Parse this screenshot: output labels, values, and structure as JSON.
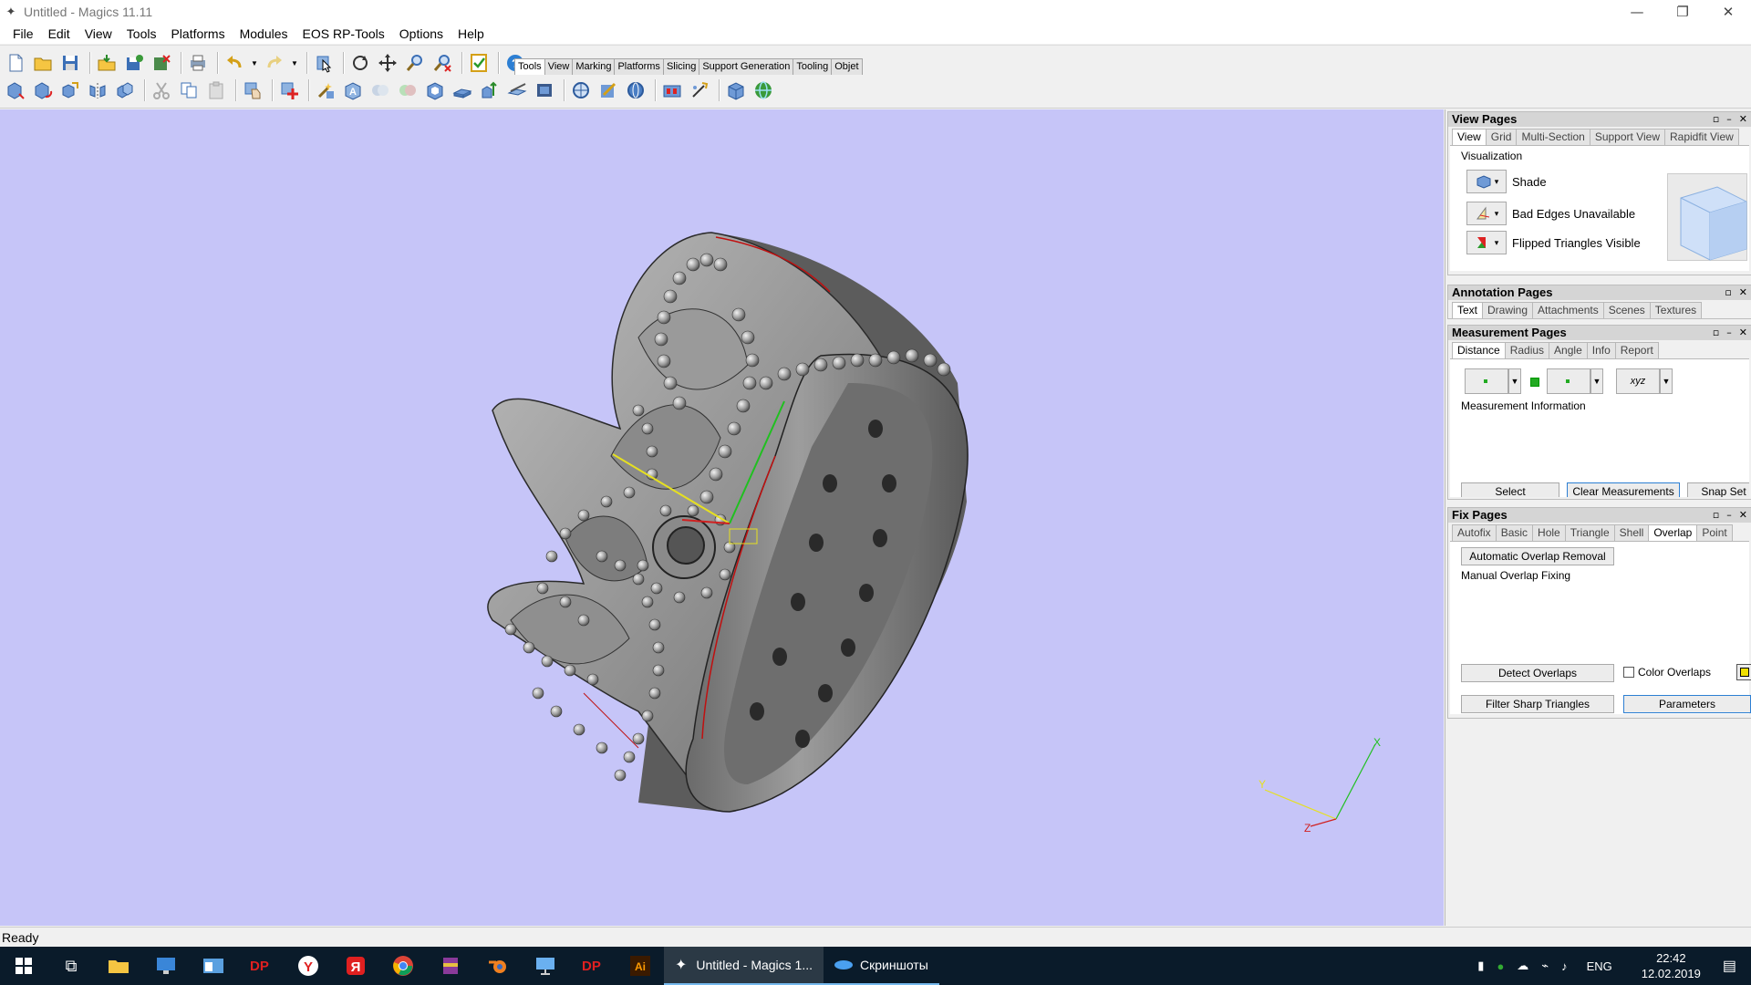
{
  "window": {
    "title": "Untitled - Magics 11.11"
  },
  "menu": [
    "File",
    "Edit",
    "View",
    "Tools",
    "Platforms",
    "Modules",
    "EOS RP-Tools",
    "Options",
    "Help"
  ],
  "toolbar_tabs": [
    "Tools",
    "View",
    "Marking",
    "Platforms",
    "Slicing",
    "Support Generation",
    "Tooling",
    "Objet"
  ],
  "toolbar_active_tab": "Tools",
  "viewport": {
    "bg": "#c6c5f8",
    "triad": {
      "x": "X",
      "y": "Y",
      "z": "Z"
    }
  },
  "view_pages": {
    "title": "View Pages",
    "tabs": [
      "View",
      "Grid",
      "Multi-Section",
      "Support View",
      "Rapidfit View"
    ],
    "active_tab": "View",
    "section": "Visualization",
    "rows": [
      "Shade",
      "Bad Edges Unavailable",
      "Flipped Triangles Visible"
    ]
  },
  "annotation_pages": {
    "title": "Annotation Pages",
    "tabs": [
      "Text",
      "Drawing",
      "Attachments",
      "Scenes",
      "Textures"
    ],
    "active_tab": "Text"
  },
  "measurement_pages": {
    "title": "Measurement Pages",
    "tabs": [
      "Distance",
      "Radius",
      "Angle",
      "Info",
      "Report"
    ],
    "active_tab": "Distance",
    "info_label": "Measurement Information",
    "xyz_label": "xyz",
    "buttons": [
      "Select",
      "Clear Measurements",
      "Snap Set"
    ]
  },
  "fix_pages": {
    "title": "Fix Pages",
    "tabs": [
      "Autofix",
      "Basic",
      "Hole",
      "Triangle",
      "Shell",
      "Overlap",
      "Point"
    ],
    "active_tab": "Overlap",
    "auto_button": "Automatic Overlap Removal",
    "manual_label": "Manual Overlap Fixing",
    "detect_button": "Detect Overlaps",
    "color_label": "Color Overlaps",
    "filter_button": "Filter Sharp Triangles",
    "params_button": "Parameters"
  },
  "status": "Ready",
  "taskbar": {
    "apps": [
      {
        "label": "Untitled - Magics 1...",
        "active": true
      },
      {
        "label": "Скриншоты",
        "active": false
      }
    ],
    "lang": "ENG",
    "time": "22:42",
    "date": "12.02.2019"
  }
}
